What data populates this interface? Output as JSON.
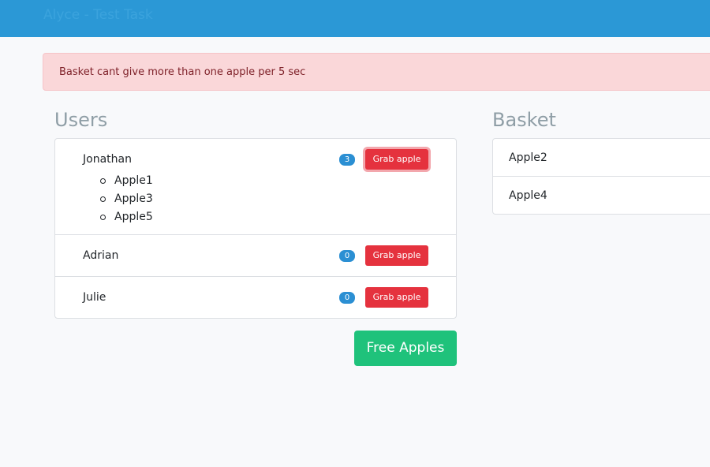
{
  "header": {
    "brand": "Alyce - Test Task"
  },
  "alert": {
    "message": "Basket cant give more than one apple per 5 sec"
  },
  "users": {
    "title": "Users",
    "items": [
      {
        "name": "Jonathan",
        "count": "3",
        "button_label": "Grab apple",
        "apples": [
          "Apple1",
          "Apple3",
          "Apple5"
        ]
      },
      {
        "name": "Adrian",
        "count": "0",
        "button_label": "Grab apple",
        "apples": []
      },
      {
        "name": "Julie",
        "count": "0",
        "button_label": "Grab apple",
        "apples": []
      }
    ],
    "free_button_label": "Free Apples"
  },
  "basket": {
    "title": "Basket",
    "items": [
      "Apple2",
      "Apple4"
    ]
  },
  "colors": {
    "navbar": "#2b98d6",
    "alert_bg": "#fad7d9",
    "alert_text": "#7d1f27",
    "grab_button": "#e5323e",
    "badge": "#2b8fd3",
    "free_button": "#1fc27b",
    "title": "#8f9ea6"
  }
}
